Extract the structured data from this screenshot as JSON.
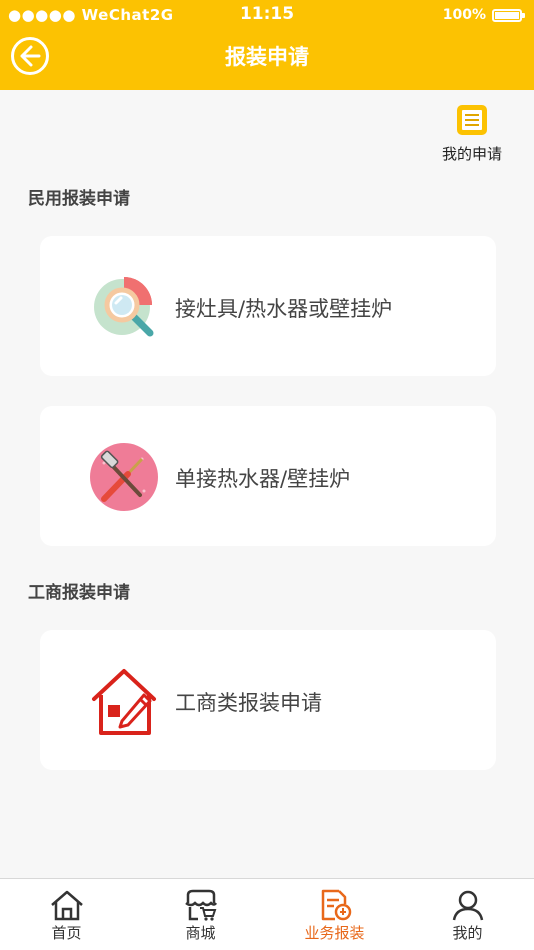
{
  "status_bar": {
    "carrier": "●●●●● WeChat2G",
    "time": "11:15",
    "battery": "100%"
  },
  "nav": {
    "title": "报装申请"
  },
  "my_applications": {
    "label": "我的申请",
    "icon": "document-list-icon"
  },
  "sections": [
    {
      "title": "民用报装申请",
      "items": [
        {
          "label": "接灶具/热水器或壁挂炉",
          "icon": "magnifier-chart-icon"
        },
        {
          "label": "单接热水器/壁挂炉",
          "icon": "tools-icon"
        }
      ]
    },
    {
      "title": "工商报装申请",
      "items": [
        {
          "label": "工商类报装申请",
          "icon": "house-pencil-icon"
        }
      ]
    }
  ],
  "tabbar": {
    "tabs": [
      {
        "label": "首页",
        "icon": "home-icon"
      },
      {
        "label": "商城",
        "icon": "shop-icon"
      },
      {
        "label": "业务报装",
        "icon": "application-icon",
        "active": true
      },
      {
        "label": "我的",
        "icon": "user-icon"
      }
    ]
  },
  "colors": {
    "brand": "#fcc202",
    "active_tab": "#e8681a",
    "background": "#f7f7f7"
  }
}
